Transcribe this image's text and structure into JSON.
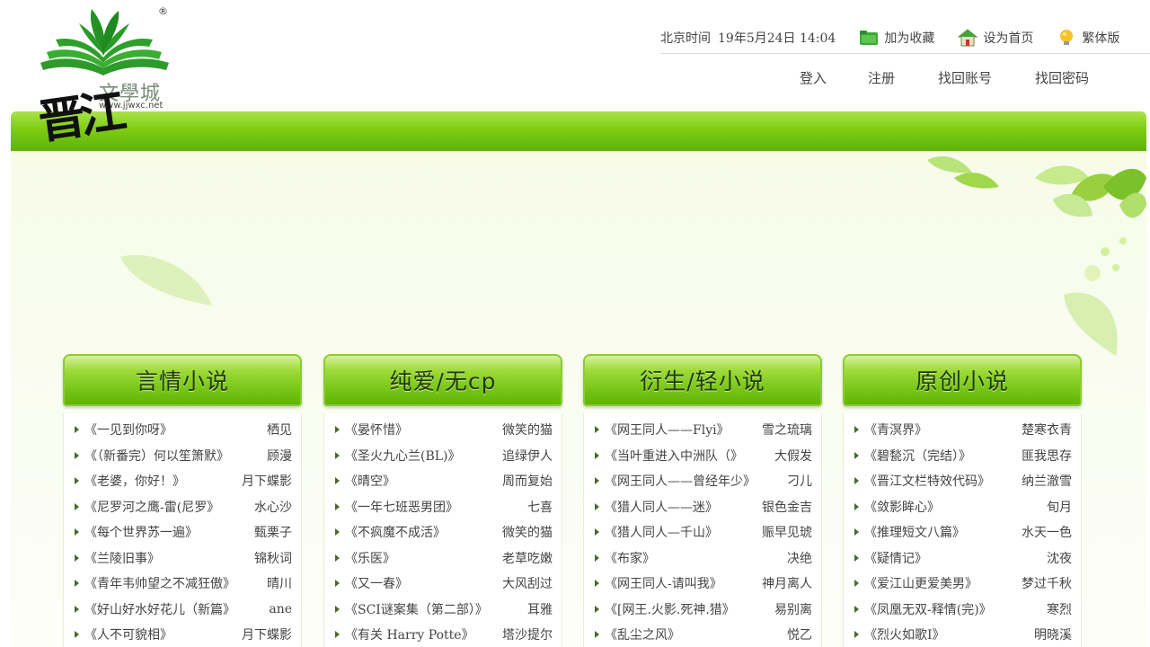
{
  "header": {
    "logo": {
      "brand": "晋江",
      "text_cn": "文學城",
      "url": "www.jjwxc.net",
      "registered": "®"
    },
    "time_label": "北京时间",
    "time_value": "19年5月24日 14:04",
    "actions": [
      {
        "label": "加为收藏",
        "icon": "folder-icon"
      },
      {
        "label": "设为首页",
        "icon": "home-icon"
      },
      {
        "label": "繁体版",
        "icon": "lightbulb-icon"
      }
    ],
    "nav": [
      {
        "label": "登入"
      },
      {
        "label": "注册"
      },
      {
        "label": "找回账号"
      },
      {
        "label": "找回密码"
      }
    ]
  },
  "colors": {
    "accent_green": "#7fcd12",
    "header_dark_green": "#1d3a06"
  },
  "categories": [
    {
      "title": "言情小说",
      "items": [
        {
          "title": "《一见到你呀》",
          "author": "栖见"
        },
        {
          "title": "《（新番完）何以笙箫默》",
          "author": "顾漫"
        },
        {
          "title": "《老婆，你好！》",
          "author": "月下蝶影"
        },
        {
          "title": "《尼罗河之鹰-雷(尼罗》",
          "author": "水心沙"
        },
        {
          "title": "《每个世界苏一遍》",
          "author": "甄栗子"
        },
        {
          "title": "《兰陵旧事》",
          "author": "锦秋词"
        },
        {
          "title": "《青年韦帅望之不减狂傲》",
          "author": "晴川"
        },
        {
          "title": "《好山好水好花儿（新篇》",
          "author": "ane"
        },
        {
          "title": "《人不可貌相》",
          "author": "月下蝶影"
        }
      ]
    },
    {
      "title": "纯爱/无cp",
      "items": [
        {
          "title": "《晏怀惜》",
          "author": "微笑的猫"
        },
        {
          "title": "《圣火九心兰(BL)》",
          "author": "追绿伊人"
        },
        {
          "title": "《晴空》",
          "author": "周而复始"
        },
        {
          "title": "《一年七班恶男团》",
          "author": "七喜"
        },
        {
          "title": "《不疯魔不成活》",
          "author": "微笑的猫"
        },
        {
          "title": "《乐医》",
          "author": "老草吃嫩"
        },
        {
          "title": "《又一春》",
          "author": "大风刮过"
        },
        {
          "title": "《SCI谜案集（第二部）》",
          "author": "耳雅"
        },
        {
          "title": "《有关 Harry Potte》",
          "author": "塔沙提尔"
        }
      ]
    },
    {
      "title": "衍生/轻小说",
      "items": [
        {
          "title": "《网王同人——Flyi》",
          "author": "雪之琉璃"
        },
        {
          "title": "《当叶重进入中洲队（》",
          "author": "大假发"
        },
        {
          "title": "《网王同人——曾经年少》",
          "author": "刁儿"
        },
        {
          "title": "《猎人同人——迷》",
          "author": "银色金吉"
        },
        {
          "title": "《猎人同人—千山》",
          "author": "赈早见琥"
        },
        {
          "title": "《布家》",
          "author": "决绝"
        },
        {
          "title": "《网王同人-请叫我》",
          "author": "神月离人"
        },
        {
          "title": "《[网王.火影.死神.猎》",
          "author": "易别离"
        },
        {
          "title": "《乱尘之风》",
          "author": "悦乙"
        }
      ]
    },
    {
      "title": "原创小说",
      "items": [
        {
          "title": "《青溟界》",
          "author": "楚寒衣青"
        },
        {
          "title": "《碧甃沉（完结）》",
          "author": "匪我思存"
        },
        {
          "title": "《晋江文栏特效代码》",
          "author": "纳兰澈雪"
        },
        {
          "title": "《敛影眸心》",
          "author": "旬月"
        },
        {
          "title": "《推理短文八篇》",
          "author": "水天一色"
        },
        {
          "title": "《疑情记》",
          "author": "沈夜"
        },
        {
          "title": "《爱江山更爱美男》",
          "author": "梦过千秋"
        },
        {
          "title": "《凤凰无双-释情(完)》",
          "author": "寒烈"
        },
        {
          "title": "《烈火如歌I》",
          "author": "明晓溪"
        }
      ]
    }
  ]
}
